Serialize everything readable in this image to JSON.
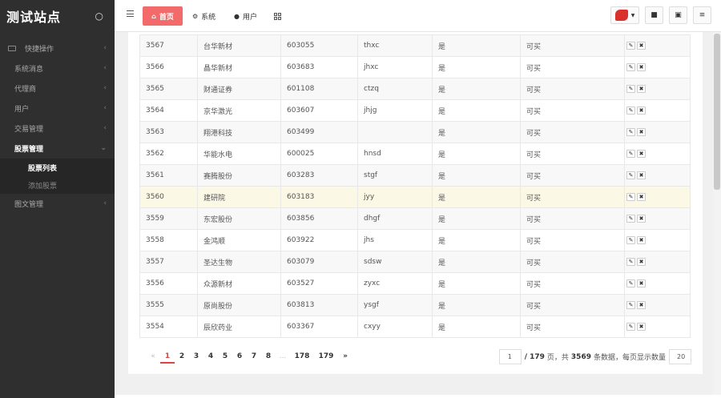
{
  "app": {
    "title": "测试站点"
  },
  "sidebar": {
    "items": [
      {
        "label": "快捷操作"
      },
      {
        "label": "系统消息"
      },
      {
        "label": "代理商"
      },
      {
        "label": "用户"
      },
      {
        "label": "交易管理"
      },
      {
        "label": "股票管理"
      },
      {
        "label": "图文管理"
      }
    ],
    "sub_items": [
      {
        "label": "股票列表"
      },
      {
        "label": "添加股票"
      }
    ]
  },
  "topbar": {
    "tabs": [
      {
        "label": "首页"
      },
      {
        "label": "系统"
      },
      {
        "label": "用户"
      }
    ]
  },
  "table": {
    "rows": [
      {
        "id": "3567",
        "name": "台华新材",
        "code": "603055",
        "py": "thxc",
        "ok": "是",
        "buy": "可买"
      },
      {
        "id": "3566",
        "name": "晶华新材",
        "code": "603683",
        "py": "jhxc",
        "ok": "是",
        "buy": "可买"
      },
      {
        "id": "3565",
        "name": "财通证券",
        "code": "601108",
        "py": "ctzq",
        "ok": "是",
        "buy": "可买"
      },
      {
        "id": "3564",
        "name": "京华激光",
        "code": "603607",
        "py": "jhjg",
        "ok": "是",
        "buy": "可买"
      },
      {
        "id": "3563",
        "name": "翔港科技",
        "code": "603499",
        "py": "",
        "ok": "是",
        "buy": "可买"
      },
      {
        "id": "3562",
        "name": "华能水电",
        "code": "600025",
        "py": "hnsd",
        "ok": "是",
        "buy": "可买"
      },
      {
        "id": "3561",
        "name": "赛腾股份",
        "code": "603283",
        "py": "stgf",
        "ok": "是",
        "buy": "可买"
      },
      {
        "id": "3560",
        "name": "建研院",
        "code": "603183",
        "py": "jyy",
        "ok": "是",
        "buy": "可买"
      },
      {
        "id": "3559",
        "name": "东宏股份",
        "code": "603856",
        "py": "dhgf",
        "ok": "是",
        "buy": "可买"
      },
      {
        "id": "3558",
        "name": "金鸿顺",
        "code": "603922",
        "py": "jhs",
        "ok": "是",
        "buy": "可买"
      },
      {
        "id": "3557",
        "name": "圣达生物",
        "code": "603079",
        "py": "sdsw",
        "ok": "是",
        "buy": "可买"
      },
      {
        "id": "3556",
        "name": "众源新材",
        "code": "603527",
        "py": "zyxc",
        "ok": "是",
        "buy": "可买"
      },
      {
        "id": "3555",
        "name": "原尚股份",
        "code": "603813",
        "py": "ysgf",
        "ok": "是",
        "buy": "可买"
      },
      {
        "id": "3554",
        "name": "辰欣药业",
        "code": "603367",
        "py": "cxyy",
        "ok": "是",
        "buy": "可买"
      }
    ]
  },
  "pagination": {
    "prev": "«",
    "pages": [
      "1",
      "2",
      "3",
      "4",
      "5",
      "6",
      "7",
      "8"
    ],
    "ellipsis": "...",
    "last_pages": [
      "178",
      "179"
    ],
    "next": "»",
    "current_page": "1",
    "total_pages_text": "/ 179",
    "text_1": "页，共",
    "total_records": "3569",
    "text_2": "条数据，每页显示数量",
    "page_size": "20"
  },
  "colors": {
    "accent": "#f36a6a",
    "sidebar_bg": "#2f2f2f",
    "highlight_row": "#fcf8e6"
  }
}
